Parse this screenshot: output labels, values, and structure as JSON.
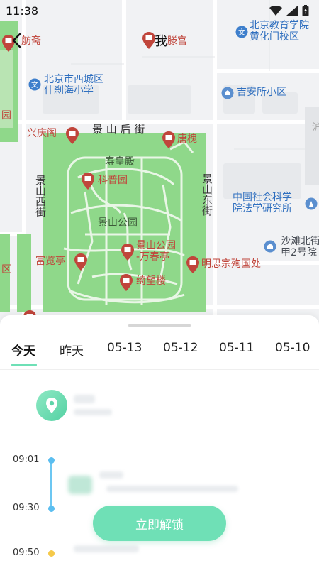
{
  "status_bar": {
    "time": "11:38"
  },
  "map": {
    "me_label": "我",
    "labels": {
      "fangzhai": "舫斋",
      "tenggong": "滕宫",
      "school_xicheng_l1": "北京市西城区",
      "school_xicheng_l2": "什刹海小学",
      "edu_college_l1": "北京教育学院",
      "edu_college_l2": "黄化门校区",
      "jiansuo": "吉安所小区",
      "xingqingge": "兴庆阁",
      "jingshan_houjie": "景 山 后 街",
      "tanghuai": "唐槐",
      "shouhuangdian": "寿皇殿",
      "kepuyuan": "科普园",
      "jingshan_xijie": "景山西街",
      "jingshan_dongjie": "景山东街",
      "cass_l1": "中国社会科学",
      "cass_l2": "院法学研究所",
      "jingshan_park": "景山公园",
      "shatan_l1": "沙滩北街",
      "shatan_l2": "甲2号院",
      "fulanting": "富览亭",
      "wanchunting_l1": "景山公园",
      "wanchunting_l2": "-万春亭",
      "mingsizong": "明思宗殉国处",
      "qu": "区",
      "yuan": "园",
      "qiwanglou": "绮望楼",
      "hu": "沪"
    }
  },
  "tabs": [
    "今天",
    "昨天",
    "05-13",
    "05-12",
    "05-11",
    "05-10"
  ],
  "active_tab": 0,
  "timeline": {
    "times": [
      "09:01",
      "09:30",
      "09:50"
    ],
    "dot_colors": [
      "#5bbef0",
      "#5bbef0",
      "#f5c94a"
    ]
  },
  "unlock_button": "立即解锁",
  "colors": {
    "accent": "#6fe0b6",
    "park_green": "#8fd88a",
    "poi_red": "#c0453b",
    "poi_blue": "#2f6fbf"
  }
}
